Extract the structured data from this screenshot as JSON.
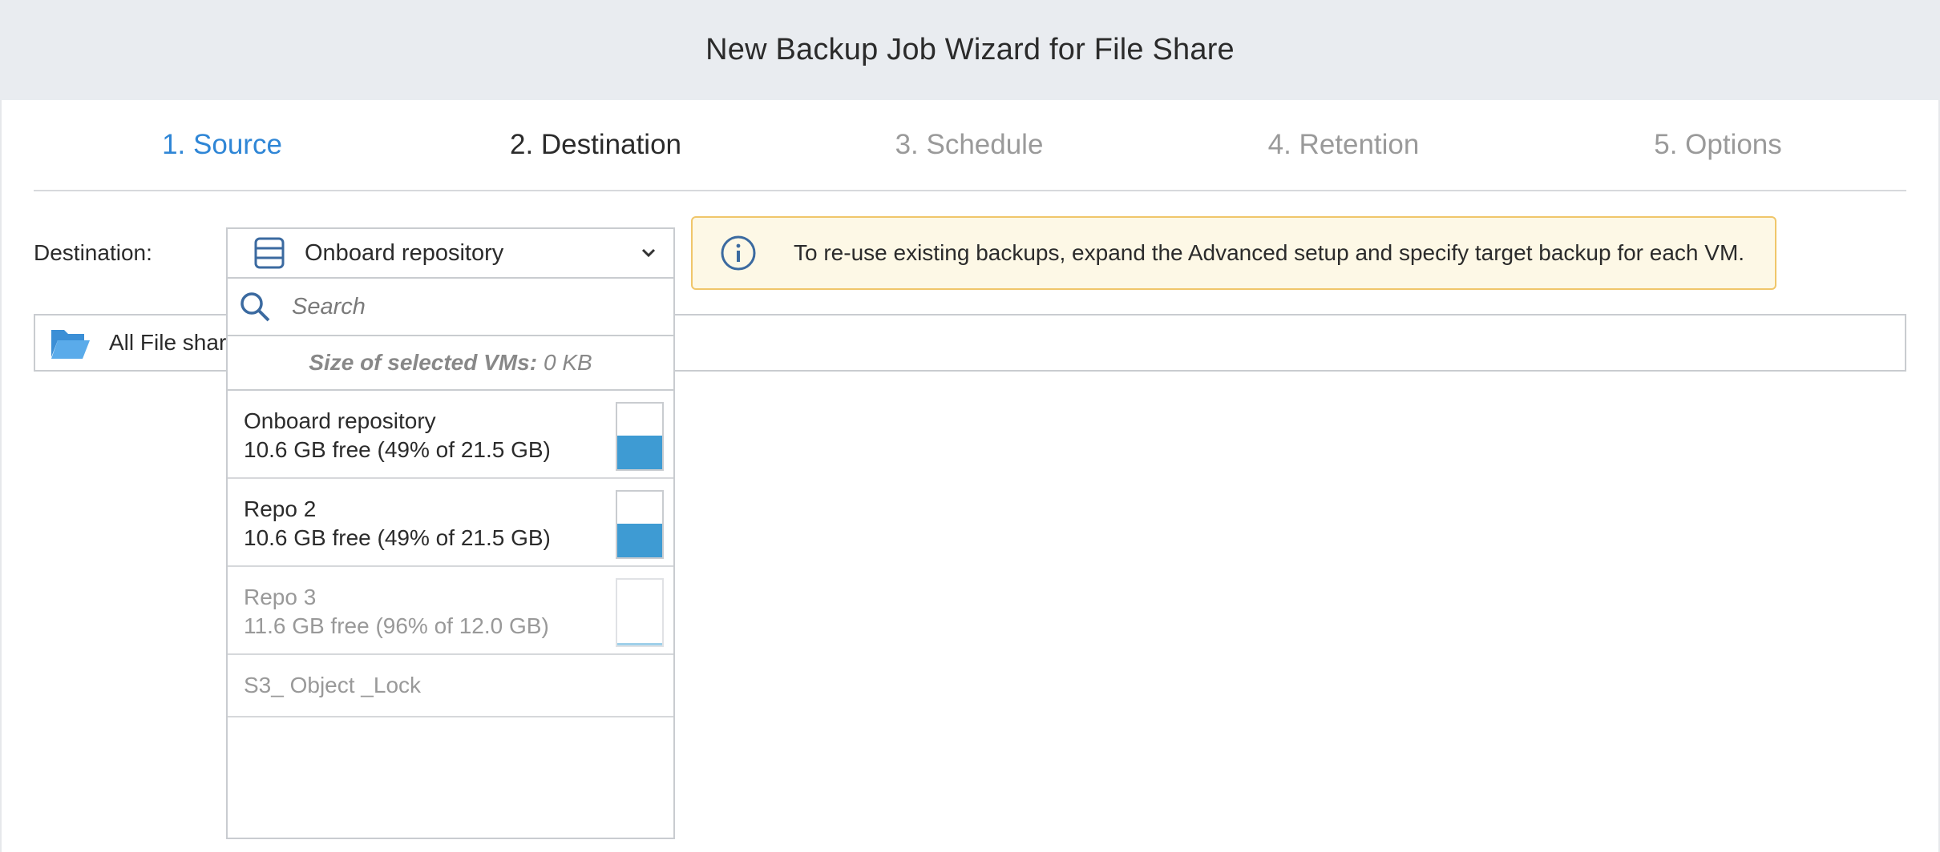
{
  "window": {
    "title": "New Backup Job Wizard for File Share"
  },
  "steps": [
    {
      "label": "1. Source",
      "state": "active"
    },
    {
      "label": "2. Destination",
      "state": "current"
    },
    {
      "label": "3. Schedule",
      "state": "future"
    },
    {
      "label": "4. Retention",
      "state": "future"
    },
    {
      "label": "5. Options",
      "state": "future"
    }
  ],
  "destination": {
    "label": "Destination:",
    "selected": "Onboard repository",
    "icon": "repository-icon"
  },
  "info": {
    "text": "To re-use existing backups, expand the Advanced setup and specify target backup for each VM.",
    "icon": "info-icon"
  },
  "tree": {
    "label": "All File share"
  },
  "dropdown": {
    "search_placeholder": "Search",
    "size_label": "Size of selected VMs:",
    "size_value": "0 KB",
    "items": [
      {
        "name": "Onboard repository",
        "free": "10.6 GB free (49% of 21.5 GB)",
        "used_fraction": 0.51,
        "enabled": true
      },
      {
        "name": "Repo 2",
        "free": "10.6 GB free (49% of 21.5 GB)",
        "used_fraction": 0.51,
        "enabled": true
      },
      {
        "name": "Repo 3",
        "free": "11.6 GB free (96% of 12.0 GB)",
        "used_fraction": 0.04,
        "enabled": false
      },
      {
        "name": "S3_ Object _Lock",
        "enabled": false
      }
    ]
  },
  "colors": {
    "accent": "#2f86d6",
    "gauge_fill": "#3e9bd3",
    "info_bg": "#fdf8e6",
    "info_border": "#f0c66a"
  }
}
